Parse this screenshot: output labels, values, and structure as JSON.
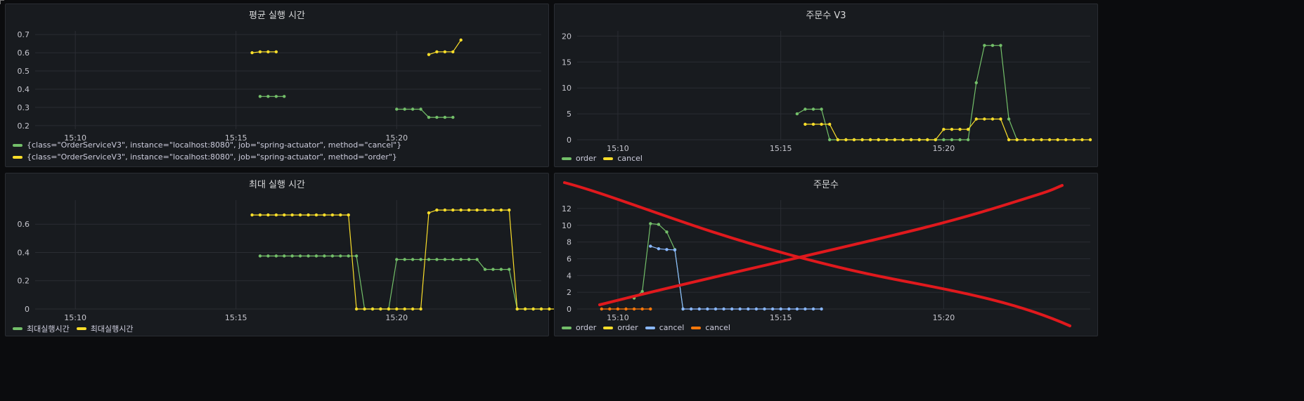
{
  "colors": {
    "green": "#73bf69",
    "yellow": "#fade2a",
    "blue": "#8ab8ff",
    "orange": "#ff780a",
    "grid": "#2a2d33",
    "annotation_red": "#e0191d"
  },
  "panels": [
    {
      "title": "평균 실행 시간",
      "chart_data": {
        "type": "line",
        "x_ticks": [
          "15:10",
          "15:15",
          "15:20"
        ],
        "y_ticks": [
          "0.2",
          "0.3",
          "0.4",
          "0.5",
          "0.6",
          "0.7"
        ],
        "ylim": [
          0.18,
          0.72
        ],
        "series": [
          {
            "name": "{class=\"OrderServiceV3\", instance=\"localhost:8080\", job=\"spring-actuator\", method=\"cancel\"}",
            "color": "#73bf69",
            "points": [
              [
                "15:15:45",
                0.36
              ],
              [
                "15:16:00",
                0.36
              ],
              [
                "15:16:15",
                0.36
              ],
              [
                "15:16:30",
                0.36
              ],
              [
                "15:20:00",
                0.29
              ],
              [
                "15:20:15",
                0.29
              ],
              [
                "15:20:30",
                0.29
              ],
              [
                "15:20:45",
                0.29
              ],
              [
                "15:21:00",
                0.245
              ],
              [
                "15:21:15",
                0.245
              ],
              [
                "15:21:30",
                0.245
              ],
              [
                "15:21:45",
                0.245
              ]
            ]
          },
          {
            "name": "{class=\"OrderServiceV3\", instance=\"localhost:8080\", job=\"spring-actuator\", method=\"order\"}",
            "color": "#fade2a",
            "points": [
              [
                "15:15:30",
                0.6
              ],
              [
                "15:15:45",
                0.605
              ],
              [
                "15:16:00",
                0.605
              ],
              [
                "15:16:15",
                0.605
              ],
              [
                "15:21:00",
                0.59
              ],
              [
                "15:21:15",
                0.605
              ],
              [
                "15:21:30",
                0.605
              ],
              [
                "15:21:45",
                0.605
              ],
              [
                "15:22:00",
                0.67
              ]
            ]
          }
        ]
      }
    },
    {
      "title": "주문수 V3",
      "chart_data": {
        "type": "line",
        "x_ticks": [
          "15:10",
          "15:15",
          "15:20"
        ],
        "y_ticks": [
          "0",
          "5",
          "10",
          "15",
          "20"
        ],
        "ylim": [
          0,
          21
        ],
        "series": [
          {
            "name": "order",
            "color": "#73bf69",
            "points": [
              [
                "15:15:30",
                5
              ],
              [
                "15:15:45",
                5.9
              ],
              [
                "15:16:00",
                5.9
              ],
              [
                "15:16:15",
                5.9
              ],
              [
                "15:16:30",
                0
              ],
              [
                "15:16:45",
                0
              ],
              [
                "15:17:00",
                0
              ],
              [
                "15:17:15",
                0
              ],
              [
                "15:17:30",
                0
              ],
              [
                "15:17:45",
                0
              ],
              [
                "15:18:00",
                0
              ],
              [
                "15:18:15",
                0
              ],
              [
                "15:18:30",
                0
              ],
              [
                "15:18:45",
                0
              ],
              [
                "15:19:00",
                0
              ],
              [
                "15:19:15",
                0
              ],
              [
                "15:19:30",
                0
              ],
              [
                "15:19:45",
                0
              ],
              [
                "15:20:00",
                0
              ],
              [
                "15:20:15",
                0
              ],
              [
                "15:20:30",
                0
              ],
              [
                "15:20:45",
                0
              ],
              [
                "15:21:00",
                11
              ],
              [
                "15:21:15",
                18.2
              ],
              [
                "15:21:30",
                18.2
              ],
              [
                "15:21:45",
                18.2
              ],
              [
                "15:22:00",
                4
              ],
              [
                "15:22:15",
                0
              ]
            ]
          },
          {
            "name": "cancel",
            "color": "#fade2a",
            "points": [
              [
                "15:15:45",
                3
              ],
              [
                "15:16:00",
                3
              ],
              [
                "15:16:15",
                3
              ],
              [
                "15:16:30",
                3
              ],
              [
                "15:16:45",
                0
              ],
              [
                "15:17:00",
                0
              ],
              [
                "15:17:15",
                0
              ],
              [
                "15:17:30",
                0
              ],
              [
                "15:17:45",
                0
              ],
              [
                "15:18:00",
                0
              ],
              [
                "15:18:15",
                0
              ],
              [
                "15:18:30",
                0
              ],
              [
                "15:18:45",
                0
              ],
              [
                "15:19:00",
                0
              ],
              [
                "15:19:15",
                0
              ],
              [
                "15:19:30",
                0
              ],
              [
                "15:19:45",
                0
              ],
              [
                "15:20:00",
                2
              ],
              [
                "15:20:15",
                2
              ],
              [
                "15:20:30",
                2
              ],
              [
                "15:20:45",
                2
              ],
              [
                "15:21:00",
                4
              ],
              [
                "15:21:15",
                4
              ],
              [
                "15:21:30",
                4
              ],
              [
                "15:21:45",
                4
              ],
              [
                "15:22:00",
                0
              ],
              [
                "15:22:15",
                0
              ],
              [
                "15:22:30",
                0
              ],
              [
                "15:22:45",
                0
              ],
              [
                "15:23:00",
                0
              ],
              [
                "15:23:15",
                0
              ],
              [
                "15:23:30",
                0
              ],
              [
                "15:23:45",
                0
              ],
              [
                "15:24:00",
                0
              ],
              [
                "15:24:15",
                0
              ],
              [
                "15:24:30",
                0
              ]
            ]
          }
        ]
      }
    },
    {
      "title": "최대 실행 시간",
      "chart_data": {
        "type": "line",
        "x_ticks": [
          "15:10",
          "15:15",
          "15:20"
        ],
        "y_ticks": [
          "0",
          "0.2",
          "0.4",
          "0.6"
        ],
        "ylim": [
          0,
          0.77
        ],
        "series": [
          {
            "name": "최대실행시간",
            "color": "#73bf69",
            "points": [
              [
                "15:15:45",
                0.375
              ],
              [
                "15:16:00",
                0.375
              ],
              [
                "15:16:15",
                0.375
              ],
              [
                "15:16:30",
                0.375
              ],
              [
                "15:16:45",
                0.375
              ],
              [
                "15:17:00",
                0.375
              ],
              [
                "15:17:15",
                0.375
              ],
              [
                "15:17:30",
                0.375
              ],
              [
                "15:17:45",
                0.375
              ],
              [
                "15:18:00",
                0.375
              ],
              [
                "15:18:15",
                0.375
              ],
              [
                "15:18:30",
                0.375
              ],
              [
                "15:18:45",
                0.375
              ],
              [
                "15:19:00",
                0
              ],
              [
                "15:19:15",
                0
              ],
              [
                "15:19:30",
                0
              ],
              [
                "15:19:45",
                0
              ],
              [
                "15:20:00",
                0.35
              ],
              [
                "15:20:15",
                0.35
              ],
              [
                "15:20:30",
                0.35
              ],
              [
                "15:20:45",
                0.35
              ],
              [
                "15:21:00",
                0.35
              ],
              [
                "15:21:15",
                0.35
              ],
              [
                "15:21:30",
                0.35
              ],
              [
                "15:21:45",
                0.35
              ],
              [
                "15:22:00",
                0.35
              ],
              [
                "15:22:15",
                0.35
              ],
              [
                "15:22:30",
                0.35
              ],
              [
                "15:22:45",
                0.28
              ],
              [
                "15:23:00",
                0.28
              ],
              [
                "15:23:15",
                0.28
              ],
              [
                "15:23:30",
                0.28
              ],
              [
                "15:23:45",
                0
              ],
              [
                "15:24:00",
                0
              ],
              [
                "15:24:15",
                0
              ],
              [
                "15:24:30",
                0
              ]
            ]
          },
          {
            "name": "최대실행시간",
            "color": "#fade2a",
            "points": [
              [
                "15:15:30",
                0.665
              ],
              [
                "15:15:45",
                0.665
              ],
              [
                "15:16:00",
                0.665
              ],
              [
                "15:16:15",
                0.665
              ],
              [
                "15:16:30",
                0.665
              ],
              [
                "15:16:45",
                0.665
              ],
              [
                "15:17:00",
                0.665
              ],
              [
                "15:17:15",
                0.665
              ],
              [
                "15:17:30",
                0.665
              ],
              [
                "15:17:45",
                0.665
              ],
              [
                "15:18:00",
                0.665
              ],
              [
                "15:18:15",
                0.665
              ],
              [
                "15:18:30",
                0.665
              ],
              [
                "15:18:45",
                0
              ],
              [
                "15:19:00",
                0
              ],
              [
                "15:19:15",
                0
              ],
              [
                "15:19:30",
                0
              ],
              [
                "15:19:45",
                0
              ],
              [
                "15:20:00",
                0
              ],
              [
                "15:20:15",
                0
              ],
              [
                "15:20:30",
                0
              ],
              [
                "15:20:45",
                0
              ],
              [
                "15:21:00",
                0.68
              ],
              [
                "15:21:15",
                0.7
              ],
              [
                "15:21:30",
                0.7
              ],
              [
                "15:21:45",
                0.7
              ],
              [
                "15:22:00",
                0.7
              ],
              [
                "15:22:15",
                0.7
              ],
              [
                "15:22:30",
                0.7
              ],
              [
                "15:22:45",
                0.7
              ],
              [
                "15:23:00",
                0.7
              ],
              [
                "15:23:15",
                0.7
              ],
              [
                "15:23:30",
                0.7
              ],
              [
                "15:23:45",
                0
              ],
              [
                "15:24:00",
                0
              ],
              [
                "15:24:15",
                0
              ],
              [
                "15:24:30",
                0
              ],
              [
                "15:24:45",
                0
              ],
              [
                "15:25:00",
                0
              ]
            ]
          }
        ]
      }
    },
    {
      "title": "주문수",
      "chart_data": {
        "type": "line",
        "x_ticks": [
          "15:10",
          "15:15",
          "15:20"
        ],
        "y_ticks": [
          "0",
          "2",
          "4",
          "6",
          "8",
          "10",
          "12"
        ],
        "ylim": [
          0,
          13
        ],
        "series": [
          {
            "name": "order",
            "color": "#73bf69",
            "points": [
              [
                "15:10:30",
                1.3
              ],
              [
                "15:10:45",
                2.1
              ],
              [
                "15:11:00",
                10.2
              ],
              [
                "15:11:15",
                10.1
              ],
              [
                "15:11:30",
                9.2
              ],
              [
                "15:11:45",
                7.1
              ],
              [
                "15:12:00",
                0
              ]
            ]
          },
          {
            "name": "order",
            "color": "#fade2a",
            "points": []
          },
          {
            "name": "cancel",
            "color": "#8ab8ff",
            "points": [
              [
                "15:11:00",
                7.5
              ],
              [
                "15:11:15",
                7.2
              ],
              [
                "15:11:30",
                7.1
              ],
              [
                "15:11:45",
                7.05
              ],
              [
                "15:12:00",
                0
              ],
              [
                "15:12:15",
                0
              ],
              [
                "15:12:30",
                0
              ],
              [
                "15:12:45",
                0
              ],
              [
                "15:13:00",
                0
              ],
              [
                "15:13:15",
                0
              ],
              [
                "15:13:30",
                0
              ],
              [
                "15:13:45",
                0
              ],
              [
                "15:14:00",
                0
              ],
              [
                "15:14:15",
                0
              ],
              [
                "15:14:30",
                0
              ],
              [
                "15:14:45",
                0
              ],
              [
                "15:15:00",
                0
              ],
              [
                "15:15:15",
                0
              ],
              [
                "15:15:30",
                0
              ],
              [
                "15:15:45",
                0
              ],
              [
                "15:16:00",
                0
              ],
              [
                "15:16:15",
                0
              ]
            ]
          },
          {
            "name": "cancel",
            "color": "#ff780a",
            "points": [
              [
                "15:09:30",
                0
              ],
              [
                "15:09:45",
                0
              ],
              [
                "15:10:00",
                0
              ],
              [
                "15:10:15",
                0
              ],
              [
                "15:10:30",
                0
              ],
              [
                "15:10:45",
                0
              ],
              [
                "15:11:00",
                0
              ]
            ]
          }
        ]
      }
    }
  ]
}
